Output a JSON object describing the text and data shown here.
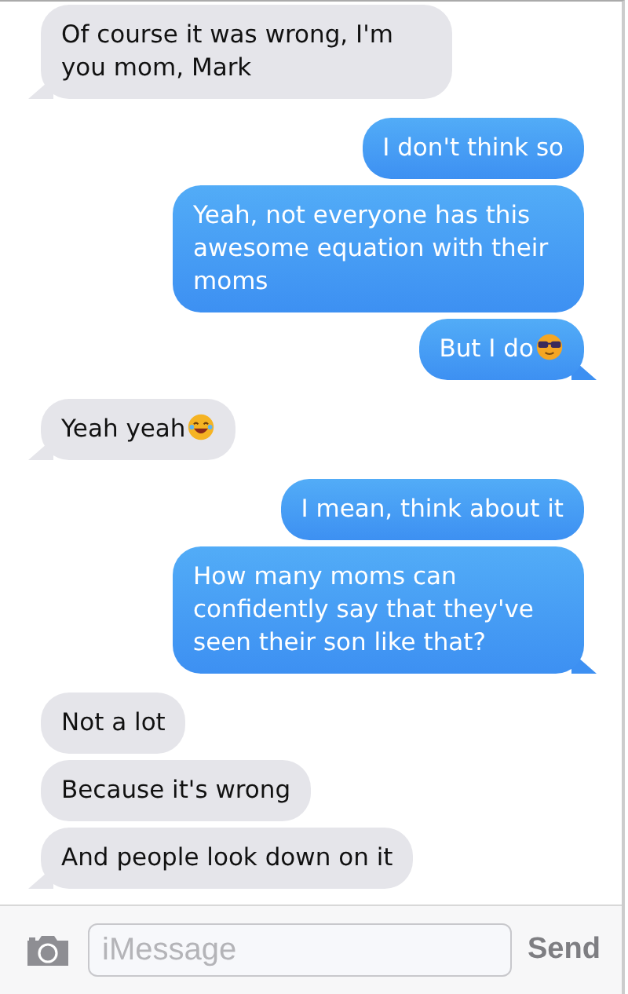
{
  "messages": [
    {
      "outgoing": false,
      "text": "Of course it was wrong, I'm you mom, Mark",
      "kind": "plain",
      "tail": true
    },
    {
      "outgoing": true,
      "text": "I don't think so",
      "kind": "plain",
      "tail": false
    },
    {
      "outgoing": true,
      "text": "Yeah, not everyone has this awesome equation with their moms",
      "kind": "plain",
      "tail": false
    },
    {
      "outgoing": true,
      "text": "But I do",
      "kind": "sunglasses",
      "tail": true
    },
    {
      "outgoing": false,
      "text": "Yeah yeah",
      "kind": "laughing",
      "tail": true
    },
    {
      "outgoing": true,
      "text": "I mean, think about it",
      "kind": "plain",
      "tail": false
    },
    {
      "outgoing": true,
      "text": "How many moms can confidently say that they've seen their son like that?",
      "kind": "plain",
      "tail": true
    },
    {
      "outgoing": false,
      "text": "Not a lot",
      "kind": "plain",
      "tail": false
    },
    {
      "outgoing": false,
      "text": "Because it's wrong",
      "kind": "plain",
      "tail": false
    },
    {
      "outgoing": false,
      "text": "And people look down on it",
      "kind": "plain",
      "tail": true
    }
  ],
  "composer": {
    "placeholder": "iMessage",
    "send_label": "Send"
  }
}
